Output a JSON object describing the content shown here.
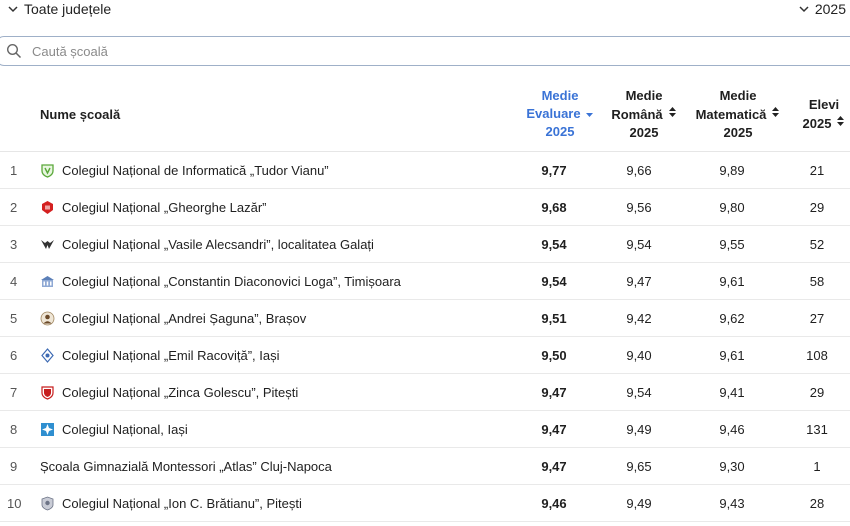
{
  "filters": {
    "county_label": "Toate județele",
    "year_label": "2025"
  },
  "search": {
    "placeholder": "Caută școală"
  },
  "table": {
    "headers": {
      "name": "Nume școală",
      "avg_eval": [
        "Medie",
        "Evaluare",
        "2025"
      ],
      "avg_ro": [
        "Medie",
        "Română",
        "2025"
      ],
      "avg_math": [
        "Medie",
        "Matematică",
        "2025"
      ],
      "students": [
        "Elevi",
        "2025"
      ]
    },
    "rows": [
      {
        "idx": "1",
        "name": "Colegiul Național de Informatică „Tudor Vianu”",
        "eval": "9,77",
        "ro": "9,66",
        "math": "9,89",
        "students": "21",
        "logo": "shield-green-icon"
      },
      {
        "idx": "2",
        "name": "Colegiul Național „Gheorghe Lazăr”",
        "eval": "9,68",
        "ro": "9,56",
        "math": "9,80",
        "students": "29",
        "logo": "red-crest-icon"
      },
      {
        "idx": "3",
        "name": "Colegiul Național „Vasile Alecsandri”, localitatea Galați",
        "eval": "9,54",
        "ro": "9,54",
        "math": "9,55",
        "students": "52",
        "logo": "wings-icon"
      },
      {
        "idx": "4",
        "name": "Colegiul Național „Constantin Diaconovici Loga”, Timișoara",
        "eval": "9,54",
        "ro": "9,47",
        "math": "9,61",
        "students": "58",
        "logo": "building-icon"
      },
      {
        "idx": "5",
        "name": "Colegiul Național „Andrei Șaguna”, Brașov",
        "eval": "9,51",
        "ro": "9,42",
        "math": "9,62",
        "students": "27",
        "logo": "portrait-icon"
      },
      {
        "idx": "6",
        "name": "Colegiul Național „Emil Racoviță”, Iași",
        "eval": "9,50",
        "ro": "9,40",
        "math": "9,61",
        "students": "108",
        "logo": "diamond-crest-icon"
      },
      {
        "idx": "7",
        "name": "Colegiul Național „Zinca Golescu”, Pitești",
        "eval": "9,47",
        "ro": "9,54",
        "math": "9,41",
        "students": "29",
        "logo": "red-shield-icon"
      },
      {
        "idx": "8",
        "name": "Colegiul Național, Iași",
        "eval": "9,47",
        "ro": "9,49",
        "math": "9,46",
        "students": "131",
        "logo": "blue-cross-icon"
      },
      {
        "idx": "9",
        "name": "Școala Gimnazială Montessori „Atlas” Cluj-Napoca",
        "eval": "9,47",
        "ro": "9,65",
        "math": "9,30",
        "students": "1",
        "logo": ""
      },
      {
        "idx": "10",
        "name": "Colegiul Național „Ion C. Brătianu”, Pitești",
        "eval": "9,46",
        "ro": "9,49",
        "math": "9,43",
        "students": "28",
        "logo": "grey-crest-icon"
      }
    ]
  },
  "colors": {
    "accent": "#3a73d6",
    "search_border": "#9fb0c8",
    "row_border": "#e9e9e9"
  }
}
